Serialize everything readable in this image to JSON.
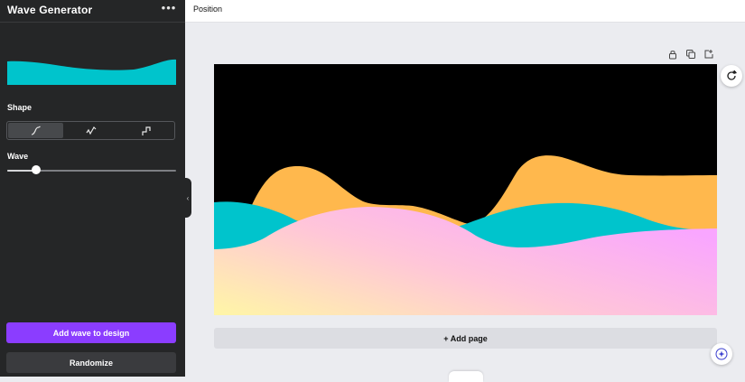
{
  "sidebar": {
    "title": "Wave Generator",
    "more_label": "•••",
    "shape_label": "Shape",
    "shape_options": [
      {
        "icon": "smooth-wave-icon",
        "active": true
      },
      {
        "icon": "peak-wave-icon",
        "active": false
      },
      {
        "icon": "step-wave-icon",
        "active": false
      }
    ],
    "wave_label": "Wave",
    "wave_level": 0.17,
    "preview_color": "#00c4cc",
    "add_button": "Add wave to design",
    "randomize_button": "Randomize",
    "collapse_icon": "‹"
  },
  "topbar": {
    "position_label": "Position"
  },
  "canvas": {
    "background": "#000000",
    "colors": {
      "orange": "#ffb84d",
      "teal": "#00c4cc",
      "gradient_start": "#fff6a6",
      "gradient_mid": "#ffc6d8",
      "gradient_end": "#f9a6ff"
    },
    "add_page_label": "+ Add page"
  },
  "accent": "#8b3dff"
}
